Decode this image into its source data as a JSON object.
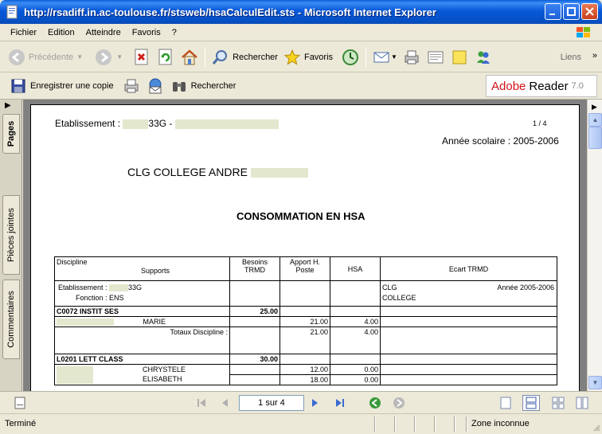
{
  "window": {
    "title": "http://rsadiff.in.ac-toulouse.fr/stsweb/hsaCalculEdit.sts - Microsoft Internet Explorer"
  },
  "menu": [
    "Fichier",
    "Edition",
    "Atteindre",
    "Favoris",
    "?"
  ],
  "toolbar": {
    "back": "Précédente",
    "search": "Rechercher",
    "favorites": "Favoris",
    "links": "Liens"
  },
  "acrobat": {
    "save_copy": "Enregistrer une copie",
    "search": "Rechercher",
    "logo_adobe": "Adobe",
    "logo_reader": "Reader",
    "logo_version": "7.0"
  },
  "sidetabs": [
    "Pages",
    "Pièces jointes",
    "Commentaires"
  ],
  "document": {
    "etab_label": "Etablissement :",
    "etab_code": "33G -",
    "page_count": "1 / 4",
    "year": "Année scolaire : 2005-2006",
    "college": "CLG COLLEGE ANDRE",
    "heading": "CONSOMMATION EN HSA",
    "table": {
      "col_discipline": "Discipline",
      "col_supports": "Supports",
      "col_besoins": "Besoins TRMD",
      "col_apport": "Apport H. Poste",
      "col_hsa": "HSA",
      "col_ecart": "Ecart TRMD",
      "etab_label": "Etablissement :",
      "etab_code": "33G",
      "fonction": "Fonction :  ENS",
      "clg": "CLG",
      "college": "COLLEGE",
      "annee": "Année 2005-2006",
      "rows": [
        {
          "label": "C0072 INSTIT SES",
          "besoins": "25.00"
        },
        {
          "name": "MARIE",
          "apport": "21.00",
          "hsa": "4.00"
        },
        {
          "totals_label": "Totaux Discipline :",
          "apport": "21.00",
          "hsa": "4.00"
        },
        {
          "label": "L0201 LETT CLASS",
          "besoins": "30.00"
        },
        {
          "name": "CHRYSTELE",
          "apport": "12.00",
          "hsa": "0.00"
        },
        {
          "name": "ELISABETH",
          "apport": "18.00",
          "hsa": "0.00"
        }
      ]
    }
  },
  "navbar": {
    "page_field": "1 sur 4"
  },
  "status": {
    "left": "Terminé",
    "zone": "Zone inconnue"
  }
}
